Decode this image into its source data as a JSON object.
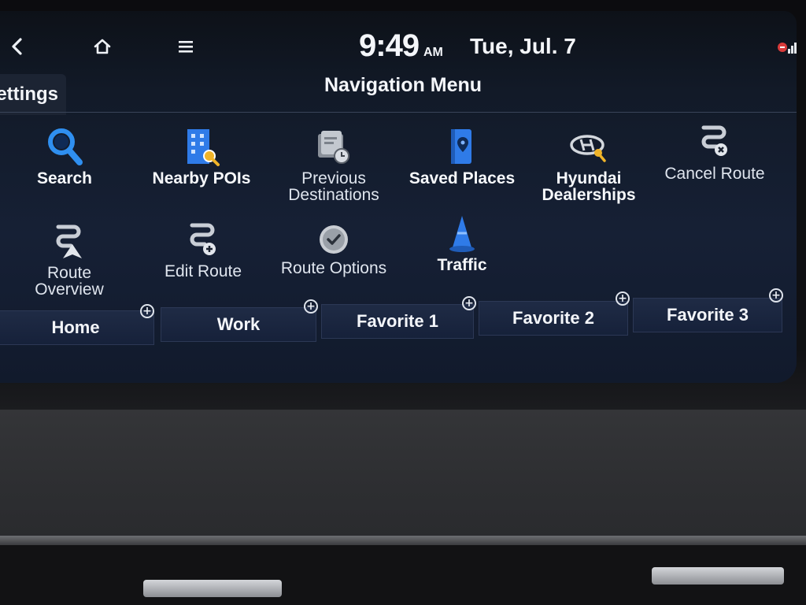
{
  "status_bar": {
    "back_icon": "chevron-left-icon",
    "home_icon": "home-icon",
    "menu_icon": "hamburger-menu-icon",
    "time": "9:49",
    "ampm": "AM",
    "date": "Tue, Jul. 7",
    "signal_icon": "signal-strength-icon"
  },
  "settings_tab": {
    "label": "ettings"
  },
  "header": {
    "title": "Navigation Menu"
  },
  "menu_items": [
    {
      "label": "Search",
      "icon": "magnifier-icon",
      "bold": true
    },
    {
      "label": "Nearby POIs",
      "icon": "building-search-icon",
      "bold": true
    },
    {
      "label": "Previous\nDestinations",
      "icon": "history-folder-icon",
      "bold": false
    },
    {
      "label": "Saved Places",
      "icon": "saved-places-book-icon",
      "bold": true
    },
    {
      "label": "Hyundai\nDealerships",
      "icon": "hyundai-logo-search-icon",
      "bold": true
    },
    {
      "label": "Cancel Route",
      "icon": "route-cancel-icon",
      "bold": false
    },
    {
      "label": "Route\nOverview",
      "icon": "route-overview-icon",
      "bold": false
    },
    {
      "label": "Edit Route",
      "icon": "route-add-icon",
      "bold": false
    },
    {
      "label": "Route Options",
      "icon": "checkmark-circle-icon",
      "bold": false
    },
    {
      "label": "Traffic",
      "icon": "traffic-cone-icon",
      "bold": true
    }
  ],
  "favorites": [
    {
      "label": "Home"
    },
    {
      "label": "Work"
    },
    {
      "label": "Favorite 1"
    },
    {
      "label": "Favorite 2"
    },
    {
      "label": "Favorite 3"
    }
  ],
  "colors": {
    "accent_blue": "#2f7be8",
    "text": "#f4f6fa",
    "screen_bg": "#142035"
  }
}
